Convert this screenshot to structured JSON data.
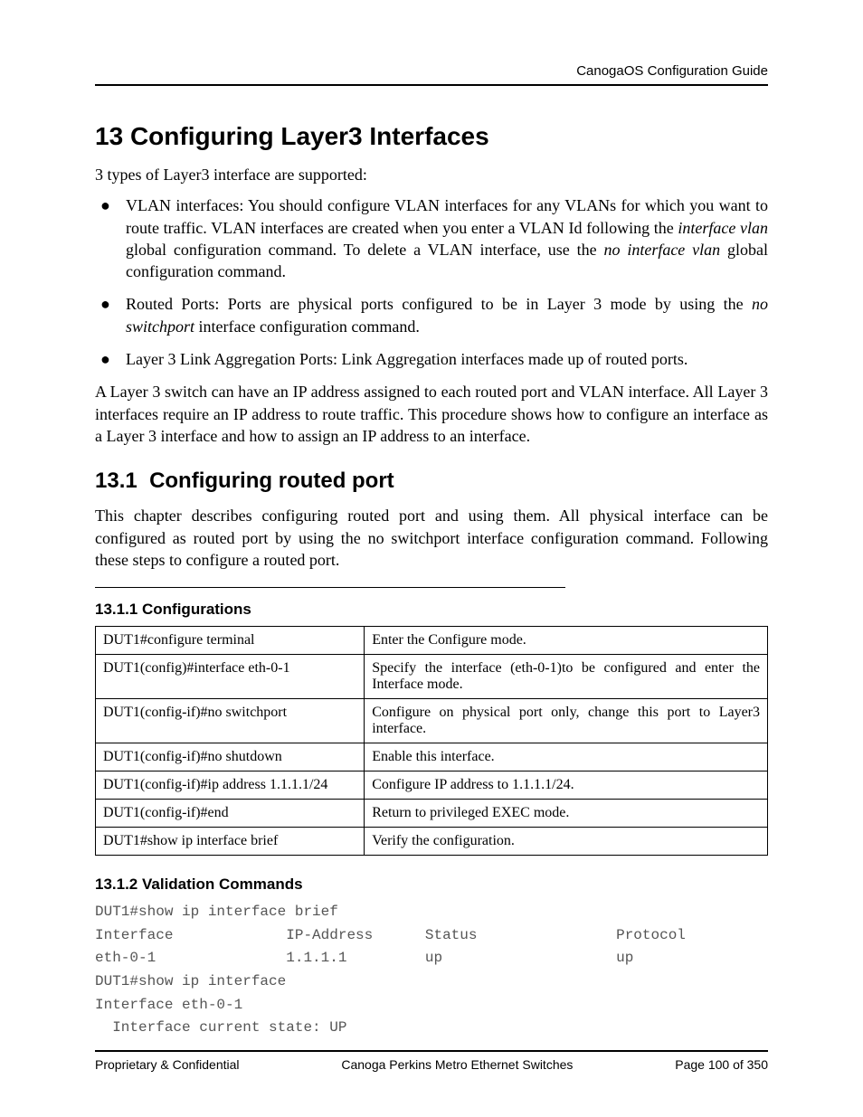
{
  "header": {
    "right": "CanogaOS Configuration Guide"
  },
  "chapter": {
    "number": "13",
    "title": "Configuring Layer3 Interfaces",
    "intro": "3 types of Layer3 interface are supported:",
    "bullets": {
      "b0": {
        "pre": "VLAN interfaces: You should configure VLAN interfaces for any VLANs for which you want to route traffic. VLAN interfaces are created when you enter a VLAN Id following the ",
        "i1": "interface vlan",
        "mid": " global configuration command. To delete a VLAN interface, use the ",
        "i2": "no interface vlan",
        "post": " global configuration command."
      },
      "b1": {
        "pre": "Routed Ports: Ports are physical ports configured to be in Layer 3 mode by using the ",
        "i1": "no switchport",
        "post": " interface configuration command."
      },
      "b2": "Layer 3 Link Aggregation Ports: Link Aggregation interfaces made up of routed ports."
    },
    "para2": "A Layer 3 switch can have an IP address assigned to each routed port and VLAN interface. All Layer 3 interfaces require an IP address to route traffic. This procedure shows how to configure an interface as a Layer 3 interface and how to assign an IP address to an interface."
  },
  "section": {
    "num": "13.1",
    "title": "Configuring routed port",
    "intro": "This chapter describes configuring routed port and using them. All physical interface can be configured as routed port by using the no switchport interface configuration command. Following these steps to configure a routed port."
  },
  "sub1": {
    "num": "13.1.1",
    "title": "Configurations",
    "rows": [
      {
        "cmd": "DUT1#configure terminal",
        "desc": "Enter the Configure mode."
      },
      {
        "cmd": "DUT1(config)#interface eth-0-1",
        "desc": "Specify the interface (eth-0-1)to be configured and enter the Interface mode."
      },
      {
        "cmd": "DUT1(config-if)#no switchport",
        "desc": "Configure on physical port only, change this port to Layer3 interface."
      },
      {
        "cmd": "DUT1(config-if)#no shutdown",
        "desc": "Enable this interface."
      },
      {
        "cmd": "DUT1(config-if)#ip address 1.1.1.1/24",
        "desc": "Configure IP address to 1.1.1.1/24."
      },
      {
        "cmd": "DUT1(config-if)#end",
        "desc": "Return to privileged EXEC mode."
      },
      {
        "cmd": "DUT1#show ip interface brief",
        "desc": "Verify the configuration."
      }
    ]
  },
  "sub2": {
    "num": "13.1.2",
    "title": "Validation Commands",
    "output": "DUT1#show ip interface brief\nInterface             IP-Address      Status                Protocol\neth-0-1               1.1.1.1         up                    up\nDUT1#show ip interface\nInterface eth-0-1\n  Interface current state: UP"
  },
  "footer": {
    "left": "Proprietary & Confidential",
    "center": "Canoga Perkins Metro Ethernet Switches",
    "right": "Page 100 of 350"
  }
}
